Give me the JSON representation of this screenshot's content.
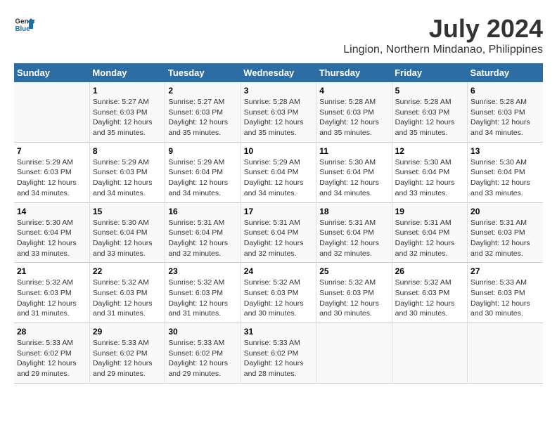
{
  "header": {
    "logo_line1": "General",
    "logo_line2": "Blue",
    "title": "July 2024",
    "subtitle": "Lingion, Northern Mindanao, Philippines"
  },
  "calendar": {
    "days_of_week": [
      "Sunday",
      "Monday",
      "Tuesday",
      "Wednesday",
      "Thursday",
      "Friday",
      "Saturday"
    ],
    "weeks": [
      [
        {
          "num": "",
          "info": ""
        },
        {
          "num": "1",
          "info": "Sunrise: 5:27 AM\nSunset: 6:03 PM\nDaylight: 12 hours\nand 35 minutes."
        },
        {
          "num": "2",
          "info": "Sunrise: 5:27 AM\nSunset: 6:03 PM\nDaylight: 12 hours\nand 35 minutes."
        },
        {
          "num": "3",
          "info": "Sunrise: 5:28 AM\nSunset: 6:03 PM\nDaylight: 12 hours\nand 35 minutes."
        },
        {
          "num": "4",
          "info": "Sunrise: 5:28 AM\nSunset: 6:03 PM\nDaylight: 12 hours\nand 35 minutes."
        },
        {
          "num": "5",
          "info": "Sunrise: 5:28 AM\nSunset: 6:03 PM\nDaylight: 12 hours\nand 35 minutes."
        },
        {
          "num": "6",
          "info": "Sunrise: 5:28 AM\nSunset: 6:03 PM\nDaylight: 12 hours\nand 34 minutes."
        }
      ],
      [
        {
          "num": "7",
          "info": "Sunrise: 5:29 AM\nSunset: 6:03 PM\nDaylight: 12 hours\nand 34 minutes."
        },
        {
          "num": "8",
          "info": "Sunrise: 5:29 AM\nSunset: 6:03 PM\nDaylight: 12 hours\nand 34 minutes."
        },
        {
          "num": "9",
          "info": "Sunrise: 5:29 AM\nSunset: 6:04 PM\nDaylight: 12 hours\nand 34 minutes."
        },
        {
          "num": "10",
          "info": "Sunrise: 5:29 AM\nSunset: 6:04 PM\nDaylight: 12 hours\nand 34 minutes."
        },
        {
          "num": "11",
          "info": "Sunrise: 5:30 AM\nSunset: 6:04 PM\nDaylight: 12 hours\nand 34 minutes."
        },
        {
          "num": "12",
          "info": "Sunrise: 5:30 AM\nSunset: 6:04 PM\nDaylight: 12 hours\nand 33 minutes."
        },
        {
          "num": "13",
          "info": "Sunrise: 5:30 AM\nSunset: 6:04 PM\nDaylight: 12 hours\nand 33 minutes."
        }
      ],
      [
        {
          "num": "14",
          "info": "Sunrise: 5:30 AM\nSunset: 6:04 PM\nDaylight: 12 hours\nand 33 minutes."
        },
        {
          "num": "15",
          "info": "Sunrise: 5:30 AM\nSunset: 6:04 PM\nDaylight: 12 hours\nand 33 minutes."
        },
        {
          "num": "16",
          "info": "Sunrise: 5:31 AM\nSunset: 6:04 PM\nDaylight: 12 hours\nand 32 minutes."
        },
        {
          "num": "17",
          "info": "Sunrise: 5:31 AM\nSunset: 6:04 PM\nDaylight: 12 hours\nand 32 minutes."
        },
        {
          "num": "18",
          "info": "Sunrise: 5:31 AM\nSunset: 6:04 PM\nDaylight: 12 hours\nand 32 minutes."
        },
        {
          "num": "19",
          "info": "Sunrise: 5:31 AM\nSunset: 6:04 PM\nDaylight: 12 hours\nand 32 minutes."
        },
        {
          "num": "20",
          "info": "Sunrise: 5:31 AM\nSunset: 6:03 PM\nDaylight: 12 hours\nand 32 minutes."
        }
      ],
      [
        {
          "num": "21",
          "info": "Sunrise: 5:32 AM\nSunset: 6:03 PM\nDaylight: 12 hours\nand 31 minutes."
        },
        {
          "num": "22",
          "info": "Sunrise: 5:32 AM\nSunset: 6:03 PM\nDaylight: 12 hours\nand 31 minutes."
        },
        {
          "num": "23",
          "info": "Sunrise: 5:32 AM\nSunset: 6:03 PM\nDaylight: 12 hours\nand 31 minutes."
        },
        {
          "num": "24",
          "info": "Sunrise: 5:32 AM\nSunset: 6:03 PM\nDaylight: 12 hours\nand 30 minutes."
        },
        {
          "num": "25",
          "info": "Sunrise: 5:32 AM\nSunset: 6:03 PM\nDaylight: 12 hours\nand 30 minutes."
        },
        {
          "num": "26",
          "info": "Sunrise: 5:32 AM\nSunset: 6:03 PM\nDaylight: 12 hours\nand 30 minutes."
        },
        {
          "num": "27",
          "info": "Sunrise: 5:33 AM\nSunset: 6:03 PM\nDaylight: 12 hours\nand 30 minutes."
        }
      ],
      [
        {
          "num": "28",
          "info": "Sunrise: 5:33 AM\nSunset: 6:02 PM\nDaylight: 12 hours\nand 29 minutes."
        },
        {
          "num": "29",
          "info": "Sunrise: 5:33 AM\nSunset: 6:02 PM\nDaylight: 12 hours\nand 29 minutes."
        },
        {
          "num": "30",
          "info": "Sunrise: 5:33 AM\nSunset: 6:02 PM\nDaylight: 12 hours\nand 29 minutes."
        },
        {
          "num": "31",
          "info": "Sunrise: 5:33 AM\nSunset: 6:02 PM\nDaylight: 12 hours\nand 28 minutes."
        },
        {
          "num": "",
          "info": ""
        },
        {
          "num": "",
          "info": ""
        },
        {
          "num": "",
          "info": ""
        }
      ]
    ]
  }
}
